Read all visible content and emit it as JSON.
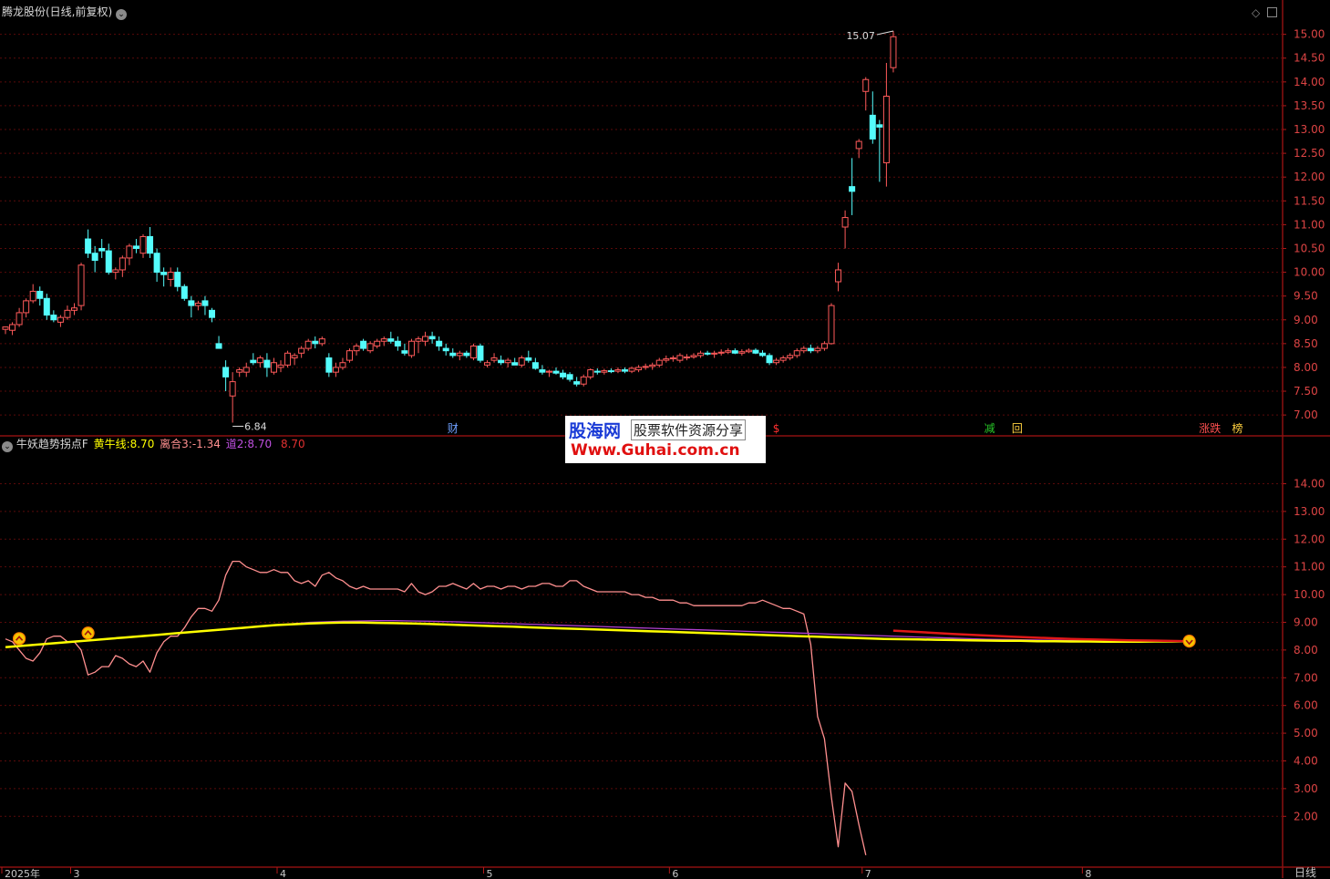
{
  "title_bar": {
    "stock_name": "腾龙股份(日线,前复权)",
    "period_label": "日线"
  },
  "indicator_header": {
    "name": "牛妖趋势拐点F",
    "yellow_line_label": "黄牛线:",
    "yellow_line_value": "8.70",
    "lihe_label": "离合3:",
    "lihe_value": "-1.34",
    "dao_label": "道2:",
    "dao_value": "8.70",
    "extra_value": "8.70"
  },
  "annotations": {
    "price_high": "15.07",
    "price_low": "6.84",
    "events": [
      {
        "text": "财",
        "color": "#6fa0ff",
        "x_date_index": 65
      },
      {
        "text": "$",
        "color": "#ff3030",
        "x_date_index": 112
      },
      {
        "text": "减",
        "color": "#28c828",
        "x_date_index": 143
      },
      {
        "text": "回",
        "color": "#ffd040",
        "x_date_index": 147
      },
      {
        "text": "涨跌",
        "color": "#ff5050",
        "x_date_index": 175
      },
      {
        "text": "榜",
        "color": "#ffd040",
        "x_date_index": 179
      }
    ]
  },
  "watermark": {
    "logo": "股海网",
    "tagline": "股票软件资源分享",
    "url": "Www.Guhai.com.cn"
  },
  "x_axis": {
    "labels": [
      {
        "text": "2025年",
        "index": 0
      },
      {
        "text": "3",
        "index": 10
      },
      {
        "text": "4",
        "index": 40
      },
      {
        "text": "5",
        "index": 70
      },
      {
        "text": "6",
        "index": 97
      },
      {
        "text": "7",
        "index": 125
      },
      {
        "text": "8",
        "index": 157
      }
    ]
  },
  "chart_data": [
    {
      "type": "candlestick",
      "title": "腾龙股份(日线,前复权)",
      "y_ticks": [
        "15.00",
        "14.50",
        "14.00",
        "13.50",
        "13.00",
        "12.50",
        "12.00",
        "11.50",
        "11.00",
        "10.50",
        "10.00",
        "9.50",
        "9.00",
        "8.50",
        "8.00",
        "7.50",
        "7.00"
      ],
      "ylim": [
        6.6,
        15.3
      ],
      "grid": true,
      "up_color": "#ff5a5a",
      "down_color": "#54fcfc",
      "candles": [
        [
          8.8,
          8.86,
          8.7,
          8.85
        ],
        [
          8.78,
          8.95,
          8.68,
          8.9
        ],
        [
          8.9,
          9.25,
          8.85,
          9.15
        ],
        [
          9.15,
          9.45,
          9.05,
          9.4
        ],
        [
          9.4,
          9.75,
          9.35,
          9.6
        ],
        [
          9.6,
          9.7,
          9.3,
          9.45
        ],
        [
          9.45,
          9.55,
          9.0,
          9.1
        ],
        [
          9.1,
          9.2,
          8.95,
          9.0
        ],
        [
          8.95,
          9.1,
          8.85,
          9.05
        ],
        [
          9.05,
          9.3,
          9.0,
          9.2
        ],
        [
          9.2,
          9.35,
          9.1,
          9.25
        ],
        [
          9.3,
          10.2,
          9.2,
          10.15
        ],
        [
          10.7,
          10.9,
          10.3,
          10.4
        ],
        [
          10.4,
          10.55,
          10.0,
          10.25
        ],
        [
          10.5,
          10.7,
          10.3,
          10.45
        ],
        [
          10.45,
          10.6,
          9.95,
          10.0
        ],
        [
          10.0,
          10.1,
          9.85,
          10.05
        ],
        [
          10.05,
          10.35,
          9.9,
          10.3
        ],
        [
          10.3,
          10.6,
          10.15,
          10.55
        ],
        [
          10.55,
          10.7,
          10.4,
          10.5
        ],
        [
          10.4,
          10.8,
          10.3,
          10.75
        ],
        [
          10.75,
          10.95,
          10.3,
          10.4
        ],
        [
          10.4,
          10.5,
          9.8,
          10.0
        ],
        [
          10.0,
          10.1,
          9.7,
          9.95
        ],
        [
          9.85,
          10.1,
          9.7,
          10.0
        ],
        [
          10.0,
          10.1,
          9.6,
          9.7
        ],
        [
          9.7,
          9.75,
          9.4,
          9.45
        ],
        [
          9.4,
          9.5,
          9.05,
          9.3
        ],
        [
          9.3,
          9.4,
          9.2,
          9.35
        ],
        [
          9.4,
          9.5,
          9.1,
          9.3
        ],
        [
          9.2,
          9.25,
          8.95,
          9.05
        ],
        [
          8.5,
          8.66,
          8.45,
          8.4
        ],
        [
          8.0,
          8.15,
          7.5,
          7.8
        ],
        [
          7.4,
          7.9,
          6.84,
          7.7
        ],
        [
          7.9,
          8.0,
          7.8,
          7.95
        ],
        [
          7.9,
          8.1,
          7.8,
          8.0
        ],
        [
          8.15,
          8.3,
          8.05,
          8.1
        ],
        [
          8.1,
          8.25,
          8.0,
          8.2
        ],
        [
          8.15,
          8.3,
          7.8,
          8.0
        ],
        [
          7.9,
          8.2,
          7.85,
          8.1
        ],
        [
          8.0,
          8.15,
          7.9,
          8.05
        ],
        [
          8.05,
          8.35,
          8.0,
          8.3
        ],
        [
          8.2,
          8.3,
          8.05,
          8.25
        ],
        [
          8.3,
          8.45,
          8.2,
          8.4
        ],
        [
          8.4,
          8.6,
          8.35,
          8.55
        ],
        [
          8.55,
          8.65,
          8.4,
          8.5
        ],
        [
          8.5,
          8.65,
          8.45,
          8.6
        ],
        [
          8.2,
          8.3,
          7.8,
          7.9
        ],
        [
          7.9,
          8.1,
          7.8,
          8.0
        ],
        [
          8.0,
          8.2,
          7.95,
          8.1
        ],
        [
          8.15,
          8.4,
          8.1,
          8.35
        ],
        [
          8.35,
          8.5,
          8.25,
          8.45
        ],
        [
          8.55,
          8.6,
          8.35,
          8.4
        ],
        [
          8.35,
          8.55,
          8.3,
          8.5
        ],
        [
          8.45,
          8.6,
          8.4,
          8.55
        ],
        [
          8.55,
          8.65,
          8.45,
          8.6
        ],
        [
          8.6,
          8.75,
          8.5,
          8.55
        ],
        [
          8.55,
          8.65,
          8.35,
          8.45
        ],
        [
          8.35,
          8.5,
          8.25,
          8.3
        ],
        [
          8.25,
          8.6,
          8.2,
          8.55
        ],
        [
          8.55,
          8.65,
          8.3,
          8.6
        ],
        [
          8.55,
          8.75,
          8.45,
          8.65
        ],
        [
          8.65,
          8.75,
          8.5,
          8.6
        ],
        [
          8.55,
          8.65,
          8.35,
          8.45
        ],
        [
          8.4,
          8.5,
          8.25,
          8.35
        ],
        [
          8.3,
          8.4,
          8.2,
          8.25
        ],
        [
          8.25,
          8.35,
          8.15,
          8.3
        ],
        [
          8.3,
          8.35,
          8.2,
          8.25
        ],
        [
          8.2,
          8.5,
          8.15,
          8.45
        ],
        [
          8.45,
          8.5,
          8.1,
          8.15
        ],
        [
          8.05,
          8.15,
          8.0,
          8.1
        ],
        [
          8.15,
          8.3,
          8.1,
          8.2
        ],
        [
          8.15,
          8.25,
          8.05,
          8.1
        ],
        [
          8.1,
          8.2,
          8.0,
          8.15
        ],
        [
          8.1,
          8.2,
          8.05,
          8.05
        ],
        [
          8.05,
          8.25,
          8.0,
          8.2
        ],
        [
          8.2,
          8.35,
          8.1,
          8.15
        ],
        [
          8.1,
          8.2,
          7.95,
          7.98
        ],
        [
          7.95,
          8.05,
          7.85,
          7.9
        ],
        [
          7.9,
          7.95,
          7.8,
          7.92
        ],
        [
          7.92,
          8.0,
          7.85,
          7.88
        ],
        [
          7.88,
          7.95,
          7.75,
          7.8
        ],
        [
          7.85,
          7.9,
          7.7,
          7.75
        ],
        [
          7.7,
          7.8,
          7.6,
          7.65
        ],
        [
          7.65,
          7.85,
          7.6,
          7.8
        ],
        [
          7.8,
          7.98,
          7.75,
          7.95
        ],
        [
          7.92,
          7.98,
          7.85,
          7.9
        ],
        [
          7.9,
          7.97,
          7.85,
          7.93
        ],
        [
          7.93,
          7.98,
          7.88,
          7.92
        ],
        [
          7.92,
          8.0,
          7.88,
          7.95
        ],
        [
          7.95,
          8.0,
          7.88,
          7.92
        ],
        [
          7.92,
          8.02,
          7.88,
          7.98
        ],
        [
          7.95,
          8.05,
          7.9,
          8.0
        ],
        [
          8.0,
          8.08,
          7.95,
          8.02
        ],
        [
          8.02,
          8.1,
          7.95,
          8.05
        ],
        [
          8.05,
          8.2,
          8.0,
          8.15
        ],
        [
          8.15,
          8.25,
          8.1,
          8.18
        ],
        [
          8.18,
          8.25,
          8.12,
          8.2
        ],
        [
          8.15,
          8.3,
          8.1,
          8.25
        ],
        [
          8.2,
          8.28,
          8.15,
          8.22
        ],
        [
          8.22,
          8.3,
          8.18,
          8.25
        ],
        [
          8.25,
          8.35,
          8.2,
          8.3
        ],
        [
          8.3,
          8.35,
          8.25,
          8.28
        ],
        [
          8.28,
          8.35,
          8.2,
          8.3
        ],
        [
          8.3,
          8.38,
          8.25,
          8.32
        ],
        [
          8.32,
          8.4,
          8.28,
          8.35
        ],
        [
          8.35,
          8.4,
          8.28,
          8.3
        ],
        [
          8.3,
          8.38,
          8.25,
          8.33
        ],
        [
          8.33,
          8.4,
          8.3,
          8.36
        ],
        [
          8.36,
          8.4,
          8.28,
          8.3
        ],
        [
          8.3,
          8.36,
          8.22,
          8.25
        ],
        [
          8.25,
          8.3,
          8.05,
          8.1
        ],
        [
          8.1,
          8.2,
          8.05,
          8.15
        ],
        [
          8.15,
          8.25,
          8.1,
          8.2
        ],
        [
          8.2,
          8.3,
          8.15,
          8.25
        ],
        [
          8.25,
          8.4,
          8.2,
          8.35
        ],
        [
          8.35,
          8.45,
          8.3,
          8.4
        ],
        [
          8.4,
          8.48,
          8.3,
          8.35
        ],
        [
          8.35,
          8.45,
          8.3,
          8.4
        ],
        [
          8.4,
          8.55,
          8.35,
          8.5
        ],
        [
          8.5,
          9.35,
          8.48,
          9.3
        ],
        [
          9.8,
          10.2,
          9.6,
          10.05
        ],
        [
          10.95,
          11.3,
          10.5,
          11.15
        ],
        [
          11.8,
          12.4,
          11.2,
          11.7
        ],
        [
          12.6,
          12.8,
          12.4,
          12.75
        ],
        [
          13.8,
          14.1,
          13.4,
          14.05
        ],
        [
          13.3,
          13.8,
          12.7,
          12.8
        ],
        [
          13.1,
          13.2,
          11.9,
          13.05
        ],
        [
          12.3,
          14.4,
          11.8,
          13.7
        ],
        [
          14.3,
          15.07,
          14.2,
          14.95
        ]
      ]
    },
    {
      "type": "line",
      "title": "牛妖趋势拐点F",
      "y_ticks": [
        "14.00",
        "13.00",
        "12.00",
        "11.00",
        "10.00",
        "9.00",
        "8.00",
        "7.00",
        "6.00",
        "5.00",
        "4.00",
        "3.00",
        "2.00"
      ],
      "ylim": [
        0.2,
        15.2
      ],
      "grid": true,
      "series": [
        {
          "name": "离合",
          "color": "#ff8f8f",
          "values": [
            8.4,
            8.3,
            8.0,
            7.7,
            7.6,
            7.9,
            8.4,
            8.5,
            8.5,
            8.3,
            8.3,
            8.0,
            7.1,
            7.2,
            7.4,
            7.4,
            7.8,
            7.7,
            7.5,
            7.4,
            7.6,
            7.2,
            7.9,
            8.3,
            8.5,
            8.5,
            8.8,
            9.2,
            9.5,
            9.5,
            9.4,
            9.8,
            10.7,
            11.2,
            11.2,
            11.0,
            10.9,
            10.8,
            10.8,
            10.9,
            10.8,
            10.8,
            10.5,
            10.4,
            10.5,
            10.3,
            10.7,
            10.8,
            10.6,
            10.5,
            10.3,
            10.2,
            10.3,
            10.2,
            10.2,
            10.2,
            10.2,
            10.2,
            10.1,
            10.4,
            10.1,
            10.0,
            10.1,
            10.3,
            10.3,
            10.4,
            10.3,
            10.2,
            10.4,
            10.2,
            10.3,
            10.3,
            10.2,
            10.3,
            10.3,
            10.2,
            10.3,
            10.3,
            10.4,
            10.4,
            10.3,
            10.3,
            10.5,
            10.5,
            10.3,
            10.2,
            10.1,
            10.1,
            10.1,
            10.1,
            10.1,
            10.0,
            10.0,
            9.9,
            9.9,
            9.8,
            9.8,
            9.8,
            9.7,
            9.7,
            9.6,
            9.6,
            9.6,
            9.6,
            9.6,
            9.6,
            9.6,
            9.6,
            9.7,
            9.7,
            9.8,
            9.7,
            9.6,
            9.5,
            9.5,
            9.4,
            9.3,
            8.2,
            5.6,
            4.8,
            2.7,
            0.9,
            3.2,
            2.9,
            1.7,
            0.6
          ]
        },
        {
          "name": "道2",
          "color": "#b040d0",
          "values": [
            8.1,
            8.15,
            8.2,
            8.25,
            8.3,
            8.35,
            8.4,
            8.45,
            8.5,
            8.55,
            8.6,
            8.65,
            8.7,
            8.75,
            8.8,
            8.85,
            8.9,
            8.95,
            9.0,
            9.02,
            9.04,
            9.05,
            9.06,
            9.06,
            9.05,
            9.04,
            9.03,
            9.01,
            8.99,
            8.97,
            8.95,
            8.93,
            8.91,
            8.89,
            8.87,
            8.85,
            8.83,
            8.81,
            8.79,
            8.77,
            8.75,
            8.73,
            8.71,
            8.69,
            8.67,
            8.65,
            8.63,
            8.61,
            8.59,
            8.57,
            8.55,
            8.53,
            8.51,
            8.49,
            8.47,
            8.45,
            8.43,
            8.41,
            8.39,
            8.38,
            8.37,
            8.36,
            8.35,
            8.34,
            8.33,
            8.33,
            8.32,
            8.32,
            8.31,
            8.31,
            8.3
          ]
        },
        {
          "name": "黄牛线",
          "color": "#ffff00",
          "values": [
            8.1,
            8.15,
            8.2,
            8.25,
            8.3,
            8.35,
            8.4,
            8.45,
            8.5,
            8.55,
            8.6,
            8.65,
            8.7,
            8.75,
            8.8,
            8.85,
            8.9,
            8.93,
            8.96,
            8.98,
            8.99,
            8.99,
            8.98,
            8.97,
            8.96,
            8.94,
            8.92,
            8.9,
            8.88,
            8.86,
            8.84,
            8.82,
            8.8,
            8.78,
            8.76,
            8.74,
            8.72,
            8.7,
            8.68,
            8.66,
            8.64,
            8.62,
            8.6,
            8.58,
            8.56,
            8.54,
            8.52,
            8.5,
            8.48,
            8.46,
            8.44,
            8.42,
            8.4,
            8.39,
            8.38,
            8.37,
            8.36,
            8.35,
            8.34,
            8.33,
            8.33,
            8.32,
            8.32,
            8.31,
            8.31,
            8.3,
            8.3,
            8.3,
            8.31,
            8.31,
            8.32
          ]
        },
        {
          "name": "红段",
          "color": "#e01818",
          "values": [
            8.32,
            8.35,
            8.4,
            8.48,
            8.58,
            8.7
          ]
        }
      ],
      "signals": [
        {
          "index": 2,
          "direction": "up"
        },
        {
          "index": 12,
          "direction": "up"
        },
        {
          "index": 172,
          "direction": "down"
        }
      ]
    }
  ]
}
